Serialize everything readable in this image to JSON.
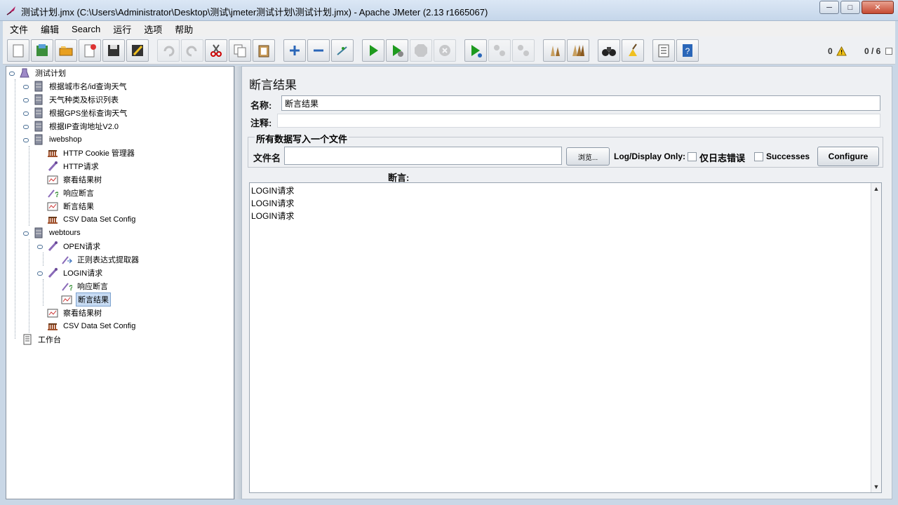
{
  "window": {
    "title": "测试计划.jmx (C:\\Users\\Administrator\\Desktop\\测试\\jmeter测试计划\\测试计划.jmx) - Apache JMeter (2.13 r1665067)",
    "minimize": "─",
    "maximize": "□",
    "close": "✕"
  },
  "menu": [
    "文件",
    "编辑",
    "Search",
    "运行",
    "选项",
    "帮助"
  ],
  "toolbar": {
    "error_count": "0",
    "threads": "0 / 6"
  },
  "tree": [
    {
      "label": "测试计划",
      "icon": "test-plan-icon"
    },
    {
      "label": "根据城市名/id查询天气",
      "icon": "thread-group-icon"
    },
    {
      "label": "天气种类及标识列表",
      "icon": "thread-group-icon"
    },
    {
      "label": "根据GPS坐标查询天气",
      "icon": "thread-group-icon"
    },
    {
      "label": "根据IP查询地址V2.0",
      "icon": "thread-group-icon"
    },
    {
      "label": "iwebshop",
      "icon": "thread-group-icon"
    },
    {
      "label": "HTTP Cookie 管理器",
      "icon": "config-icon"
    },
    {
      "label": "HTTP请求",
      "icon": "sampler-icon"
    },
    {
      "label": "察看结果树",
      "icon": "listener-icon"
    },
    {
      "label": "响应断言",
      "icon": "assertion-icon"
    },
    {
      "label": "断言结果",
      "icon": "listener-icon"
    },
    {
      "label": "CSV Data Set Config",
      "icon": "config-icon"
    },
    {
      "label": "webtours",
      "icon": "thread-group-icon"
    },
    {
      "label": "OPEN请求",
      "icon": "sampler-icon"
    },
    {
      "label": "正则表达式提取器",
      "icon": "extractor-icon"
    },
    {
      "label": "LOGIN请求",
      "icon": "sampler-icon"
    },
    {
      "label": "响应断言",
      "icon": "assertion-icon"
    },
    {
      "label": "断言结果",
      "icon": "listener-icon"
    },
    {
      "label": "察看结果树",
      "icon": "listener-icon"
    },
    {
      "label": "CSV Data Set Config",
      "icon": "config-icon"
    },
    {
      "label": "工作台",
      "icon": "workbench-icon"
    }
  ],
  "panel": {
    "title": "断言结果",
    "name_label": "名称:",
    "name_value": "断言结果",
    "comment_label": "注释:",
    "comment_value": "",
    "file_group_title": "所有数据写入一个文件",
    "filename_label": "文件名",
    "filename_value": "",
    "browse_label": "浏览...",
    "log_display_label": "Log/Display Only:",
    "errors_only_label": "仅日志错误",
    "successes_label": "Successes",
    "configure_label": "Configure",
    "assertions_label": "断言:",
    "results": [
      "LOGIN请求",
      "LOGIN请求",
      "LOGIN请求"
    ]
  }
}
